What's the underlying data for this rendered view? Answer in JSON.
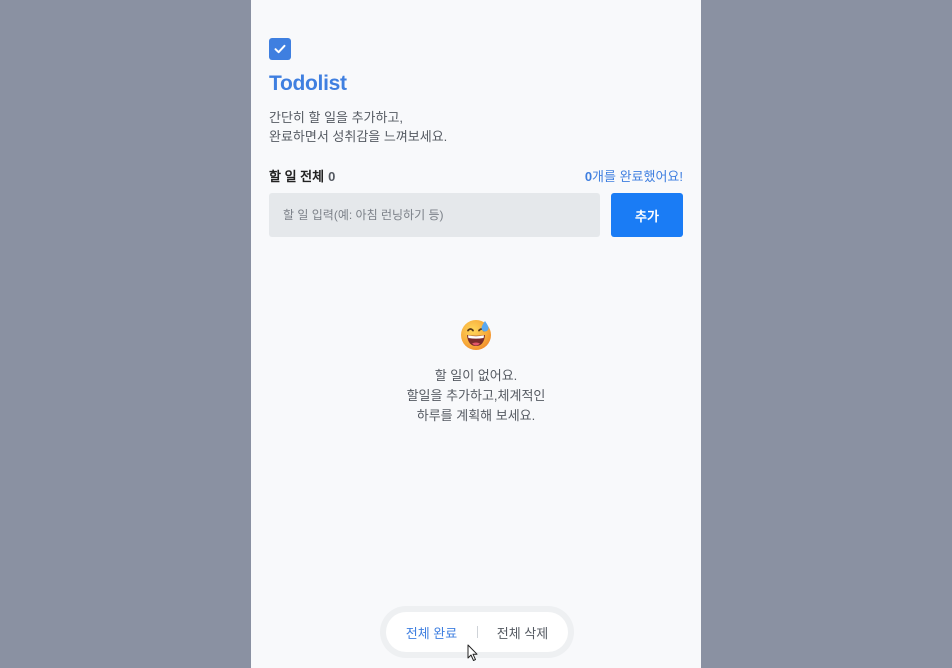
{
  "app": {
    "title": "Todolist",
    "description": [
      "간단히 할 일을 추가하고,",
      "완료하면서 성취감을 느껴보세요."
    ],
    "brand_color": "#3f7fe0"
  },
  "counts": {
    "total_label": "할 일 전체",
    "total_value": "0",
    "done_value": "0",
    "done_suffix": "개를 완료했어요!"
  },
  "input": {
    "placeholder": "할 일 입력(예: 아침 런닝하기 등)",
    "value": ""
  },
  "add_button": {
    "label": "추가",
    "color": "#1a7cf5"
  },
  "empty_state": {
    "icon": "grinning-sweat-emoji-icon",
    "lines": [
      "할 일이 없어요.",
      "할일을 추가하고,체계적인",
      "하루를 계획해 보세요."
    ]
  },
  "bottom_bar": {
    "complete_all_label": "전체 완료",
    "delete_all_label": "전체 삭제"
  },
  "icons": {
    "logo": "checkbox-checked-icon",
    "pointer": "mouse-cursor-icon"
  }
}
